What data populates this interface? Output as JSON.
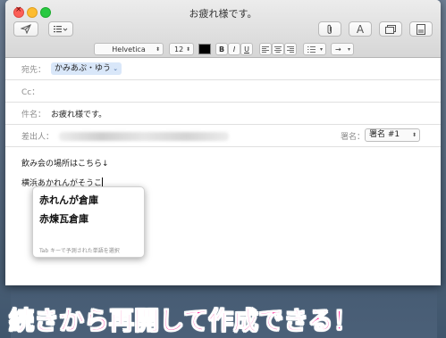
{
  "window": {
    "title": "お疲れ様です。"
  },
  "toolbar": {
    "send_icon": "paper-plane-icon",
    "header_fields_icon": "list-icon",
    "attach_icon": "paperclip-icon",
    "fonts_label": "A",
    "browser_icon": "window-icon",
    "stationery_icon": "stationery-icon"
  },
  "format": {
    "font": "Helvetica",
    "size": "12",
    "color": "#000000",
    "bold": "B",
    "italic": "I",
    "underline": "U",
    "indent": "→"
  },
  "header": {
    "to_label": "宛先：",
    "to_value": "かみあぷ・ゆう",
    "cc_label": "Cc：",
    "subject_label": "件名：",
    "subject_value": "お疲れ様です。",
    "from_label": "差出人：",
    "signature_label": "署名：",
    "signature_value": "署名 #1"
  },
  "body": {
    "line1": "飲み会の場所はこちら↓",
    "line2_prefix": "横浜",
    "line2_composing": "あかれんがそうこ"
  },
  "candidates": {
    "items": [
      "赤れんが倉庫",
      "赤煉瓦倉庫"
    ],
    "hint": "Tab キーで予測された単語を選択"
  },
  "banner": {
    "text": "続きから再開して作成できる！"
  },
  "colors": {
    "banner": "#ff2d9a",
    "to_chip": "#d9e7f9"
  }
}
